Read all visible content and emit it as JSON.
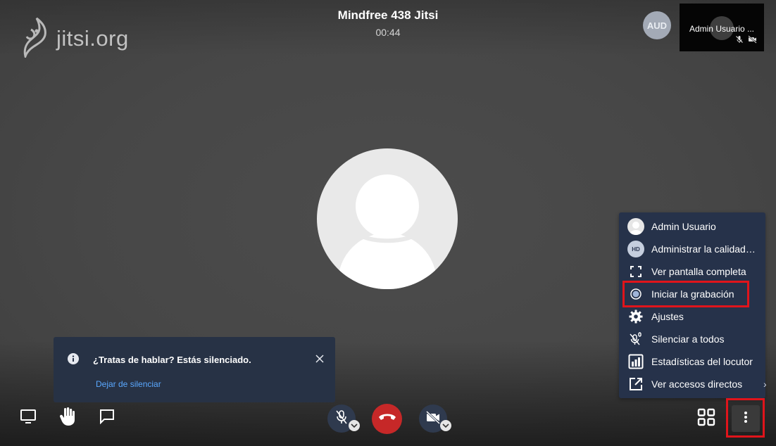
{
  "meeting": {
    "title": "Mindfree 438 Jitsi",
    "timer": "00:44"
  },
  "logo": {
    "text": "jitsi.org",
    "icon": "jitsi-logo-icon"
  },
  "participants": {
    "audio_badge": "AUD",
    "thumbnail_name": "Admin Usuario ..."
  },
  "notification": {
    "icon": "info-icon",
    "title": "¿Tratas de hablar? Estás silenciado.",
    "action": "Dejar de silenciar"
  },
  "menu": {
    "items": [
      {
        "label": "Admin Usuario",
        "icon": "avatar-icon"
      },
      {
        "label": "Administrar la calidad…",
        "icon": "hd-icon",
        "badge": "HD"
      },
      {
        "label": "Ver pantalla completa",
        "icon": "fullscreen-icon"
      },
      {
        "label": "Iniciar la grabación",
        "icon": "record-icon"
      },
      {
        "label": "Ajustes",
        "icon": "gear-icon"
      },
      {
        "label": "Silenciar a todos",
        "icon": "mute-everyone-icon"
      },
      {
        "label": "Estadísticas del locutor",
        "icon": "speaker-stats-icon"
      },
      {
        "label": "Ver accesos directos",
        "icon": "open-in-new-icon"
      }
    ]
  },
  "toolbar": {
    "left": [
      "screen-share-icon",
      "raise-hand-icon",
      "chat-icon"
    ],
    "center": [
      "microphone-muted-icon",
      "hangup-icon",
      "camera-muted-icon"
    ],
    "right": [
      "tile-view-icon",
      "more-options-icon"
    ]
  },
  "colors": {
    "background": "#474747",
    "menu_bg": "#26324a",
    "notification_bg": "#273245",
    "hangup": "#c62828",
    "highlight": "#e0141b",
    "link": "#5aa8ff"
  }
}
